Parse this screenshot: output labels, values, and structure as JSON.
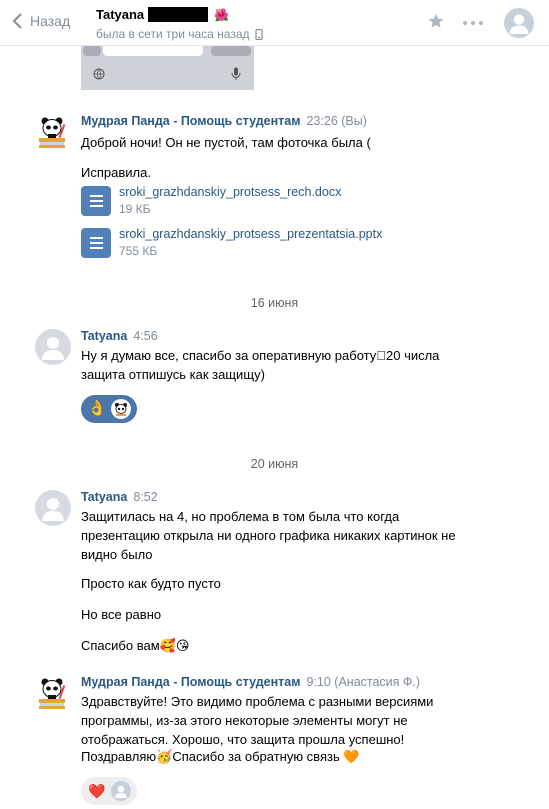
{
  "header": {
    "back_label": "Назад",
    "contact_name": "Tatyana",
    "status": "была в сети три часа назад",
    "icons": [
      "chevron-left-icon",
      "flower-emoji-icon",
      "phone-icon",
      "star-icon",
      "more-icon",
      "avatar"
    ]
  },
  "messages": [
    {
      "author": "Мудрая Панда - Помощь студентам",
      "time": "23:26 (Вы)",
      "lines": [
        "Доброй ночи! Он не пустой, там фоточка была (",
        "Исправила."
      ],
      "attachments": [
        {
          "name": "sroki_grazhdanskiy_protsess_rech.docx",
          "size": "19 КБ"
        },
        {
          "name": "sroki_grazhdanskiy_protsess_prezentatsia.pptx",
          "size": "755 КБ"
        }
      ]
    },
    {
      "date": "16 июня",
      "author": "Tatyana",
      "time": "4:56",
      "lines": [
        "Ну я думаю все, спасибо за оперативную работу􀀀20 числа",
        "защита отпишусь как защищу)"
      ],
      "reactions": [
        "ok-hand-emoji",
        "panda-avatar"
      ]
    },
    {
      "date": "20 июня",
      "author": "Tatyana",
      "time": "8:52",
      "lines": [
        "Защитилась на 4, но проблема в том была что когда",
        "презентацию открыла ни одного графика никаких картинок не",
        "видно было",
        "Просто как будто пусто",
        "Но все равно",
        "Спасибо вам"
      ]
    },
    {
      "author": "Мудрая Панда - Помощь студентам",
      "time": "9:10 (Анастасия Ф.)",
      "lines": [
        "Здравствуйте! Это видимо проблема с разными версиями",
        "программы, из-за этого некоторые элементы могут не",
        "отображаться. Хорошо, что защита прошла успешно!",
        "Поздравляю",
        "Спасибо за обратную связь"
      ],
      "reactions": [
        "heart-emoji",
        "user-avatar"
      ]
    }
  ],
  "colors": {
    "link": "#2a5885",
    "muted": "#818c99",
    "accent": "#4a76a8",
    "doc": "#5181b8"
  }
}
